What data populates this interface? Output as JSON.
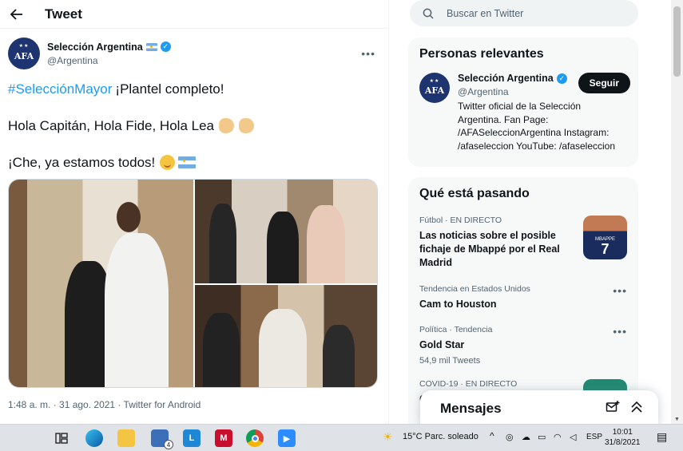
{
  "tweet_header": {
    "title": "Tweet"
  },
  "tweet": {
    "author_name": "Selección Argentina",
    "author_handle": "@Argentina",
    "avatar_text": "AFA",
    "hashtag": "#SelecciónMayor",
    "line1_rest": "¡Plantel completo!",
    "line2": "Hola Capitán, Hola Fide, Hola Lea",
    "line3": "¡Che, ya estamos todos!",
    "meta": "1:48 a. m. · 31 ago. 2021 · Twitter for Android",
    "photos": 3
  },
  "search": {
    "placeholder": "Buscar en Twitter"
  },
  "persons": {
    "heading": "Personas relevantes",
    "name": "Selección Argentina",
    "handle": "@Argentina",
    "follow_label": "Seguir",
    "bio_lines": [
      "Twitter oficial de la Selección",
      "Argentina. Fan Page:",
      "/AFASeleccionArgentina Instagram:",
      "/afaseleccion YouTube: /afaseleccion"
    ]
  },
  "trends": {
    "heading": "Qué está pasando",
    "items": [
      {
        "category": "Fútbol · EN DIRECTO",
        "title_lines": [
          "Las noticias sobre el posible",
          "fichaje de Mbappé por el Real",
          "Madrid"
        ],
        "thumb_name": "MBAPPE",
        "thumb_number": "7"
      },
      {
        "category": "Tendencia en Estados Unidos",
        "title": "Cam to Houston"
      },
      {
        "category": "Política · Tendencia",
        "title": "Gold Star",
        "sub": "54,9 mil Tweets"
      },
      {
        "category": "COVID-19 · EN DIRECTO",
        "title": "CO"
      }
    ]
  },
  "messages": {
    "title": "Mensajes"
  },
  "taskbar": {
    "weather": "15°C  Parc. soleado",
    "language": "ESP",
    "time": "10:01",
    "date": "31/8/2021",
    "mail_badge": "4"
  },
  "colors": {
    "accent": "#1d9bf0",
    "text": "#0f1419",
    "secondary": "#536471"
  }
}
